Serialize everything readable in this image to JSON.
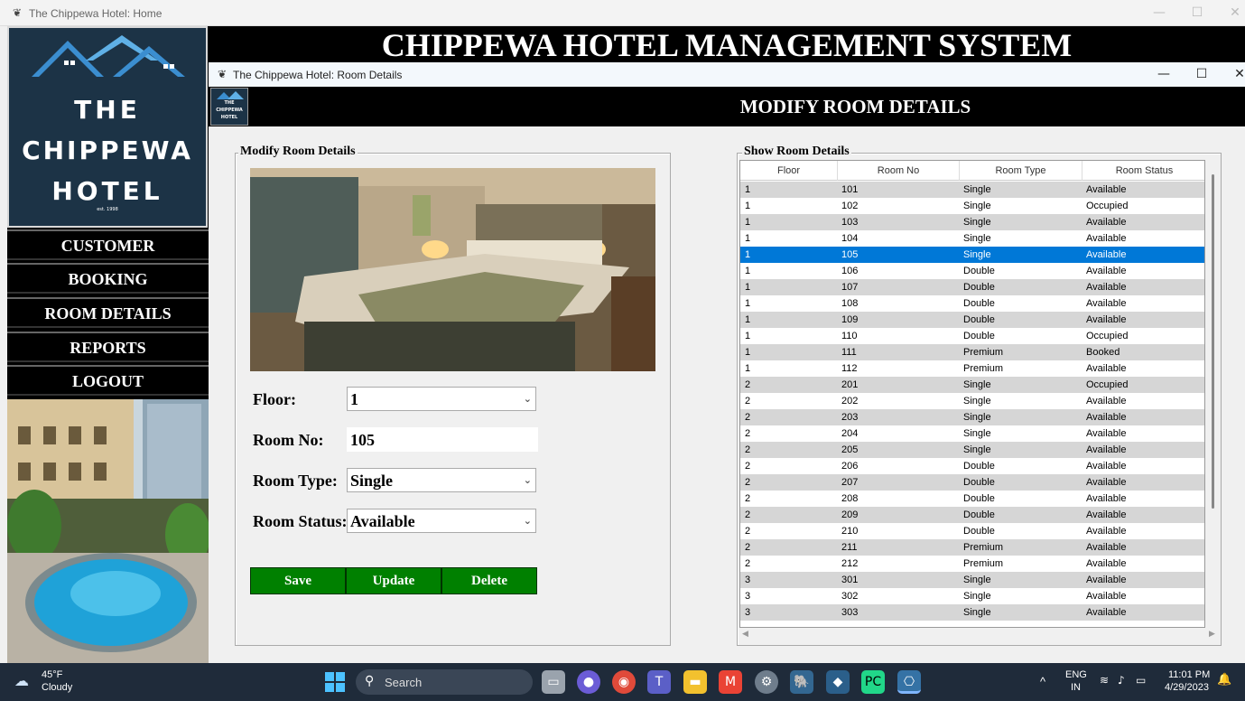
{
  "outer_window": {
    "title": "The Chippewa Hotel: Home",
    "minimize": "—",
    "maximize": "☐",
    "close": "✕"
  },
  "logo": {
    "line1": "THE",
    "line2": "CHIPPEWA",
    "line3": "HOTEL",
    "est": "est. 1998"
  },
  "nav": {
    "items": [
      {
        "label": "CUSTOMER"
      },
      {
        "label": "BOOKING"
      },
      {
        "label": "ROOM DETAILS"
      },
      {
        "label": "REPORTS"
      },
      {
        "label": "LOGOUT"
      }
    ]
  },
  "main_header": "CHIPPEWA HOTEL MANAGEMENT SYSTEM",
  "child_window": {
    "title": "The Chippewa Hotel: Room Details",
    "header": "MODIFY ROOM DETAILS",
    "mini_logo_text": [
      "THE",
      "CHIPPEWA",
      "HOTEL"
    ],
    "minimize": "—",
    "maximize": "☐",
    "close": "✕"
  },
  "form": {
    "group_label": "Modify Room Details",
    "floor_label": "Floor:",
    "floor_value": "1",
    "room_no_label": "Room No:",
    "room_no_value": "105",
    "room_type_label": "Room Type:",
    "room_type_value": "Single",
    "room_status_label": "Room Status:",
    "room_status_value": "Available",
    "dropdown_arrow": "⌄",
    "buttons": {
      "save": "Save",
      "update": "Update",
      "delete": "Delete"
    },
    "button_color": "#008000"
  },
  "table": {
    "group_label": "Show Room Details",
    "columns": [
      "Floor",
      "Room No",
      "Room Type",
      "Room Status"
    ],
    "selected_room": "105",
    "selection_color": "#0078d7",
    "rows": [
      [
        "1",
        "101",
        "Single",
        "Available"
      ],
      [
        "1",
        "102",
        "Single",
        "Occupied"
      ],
      [
        "1",
        "103",
        "Single",
        "Available"
      ],
      [
        "1",
        "104",
        "Single",
        "Available"
      ],
      [
        "1",
        "105",
        "Single",
        "Available"
      ],
      [
        "1",
        "106",
        "Double",
        "Available"
      ],
      [
        "1",
        "107",
        "Double",
        "Available"
      ],
      [
        "1",
        "108",
        "Double",
        "Available"
      ],
      [
        "1",
        "109",
        "Double",
        "Available"
      ],
      [
        "1",
        "110",
        "Double",
        "Occupied"
      ],
      [
        "1",
        "111",
        "Premium",
        "Booked"
      ],
      [
        "1",
        "112",
        "Premium",
        "Available"
      ],
      [
        "2",
        "201",
        "Single",
        "Occupied"
      ],
      [
        "2",
        "202",
        "Single",
        "Available"
      ],
      [
        "2",
        "203",
        "Single",
        "Available"
      ],
      [
        "2",
        "204",
        "Single",
        "Available"
      ],
      [
        "2",
        "205",
        "Single",
        "Available"
      ],
      [
        "2",
        "206",
        "Double",
        "Available"
      ],
      [
        "2",
        "207",
        "Double",
        "Available"
      ],
      [
        "2",
        "208",
        "Double",
        "Available"
      ],
      [
        "2",
        "209",
        "Double",
        "Available"
      ],
      [
        "2",
        "210",
        "Double",
        "Available"
      ],
      [
        "2",
        "211",
        "Premium",
        "Available"
      ],
      [
        "2",
        "212",
        "Premium",
        "Available"
      ],
      [
        "3",
        "301",
        "Single",
        "Available"
      ],
      [
        "3",
        "302",
        "Single",
        "Available"
      ],
      [
        "3",
        "303",
        "Single",
        "Available"
      ]
    ]
  },
  "taskbar": {
    "weather_temp": "45°F",
    "weather_desc": "Cloudy",
    "search_placeholder": "Search",
    "lang_line1": "ENG",
    "lang_line2": "IN",
    "time": "11:01 PM",
    "date": "4/29/2023",
    "chevron": "^",
    "apps": [
      "windows-start-icon",
      "file-explorer-taskview-icon",
      "meet-icon",
      "chrome-icon",
      "teams-icon",
      "folder-icon",
      "gmail-icon",
      "settings-icon",
      "postgres-icon",
      "app-icon",
      "pycharm-icon",
      "python-icon"
    ]
  }
}
